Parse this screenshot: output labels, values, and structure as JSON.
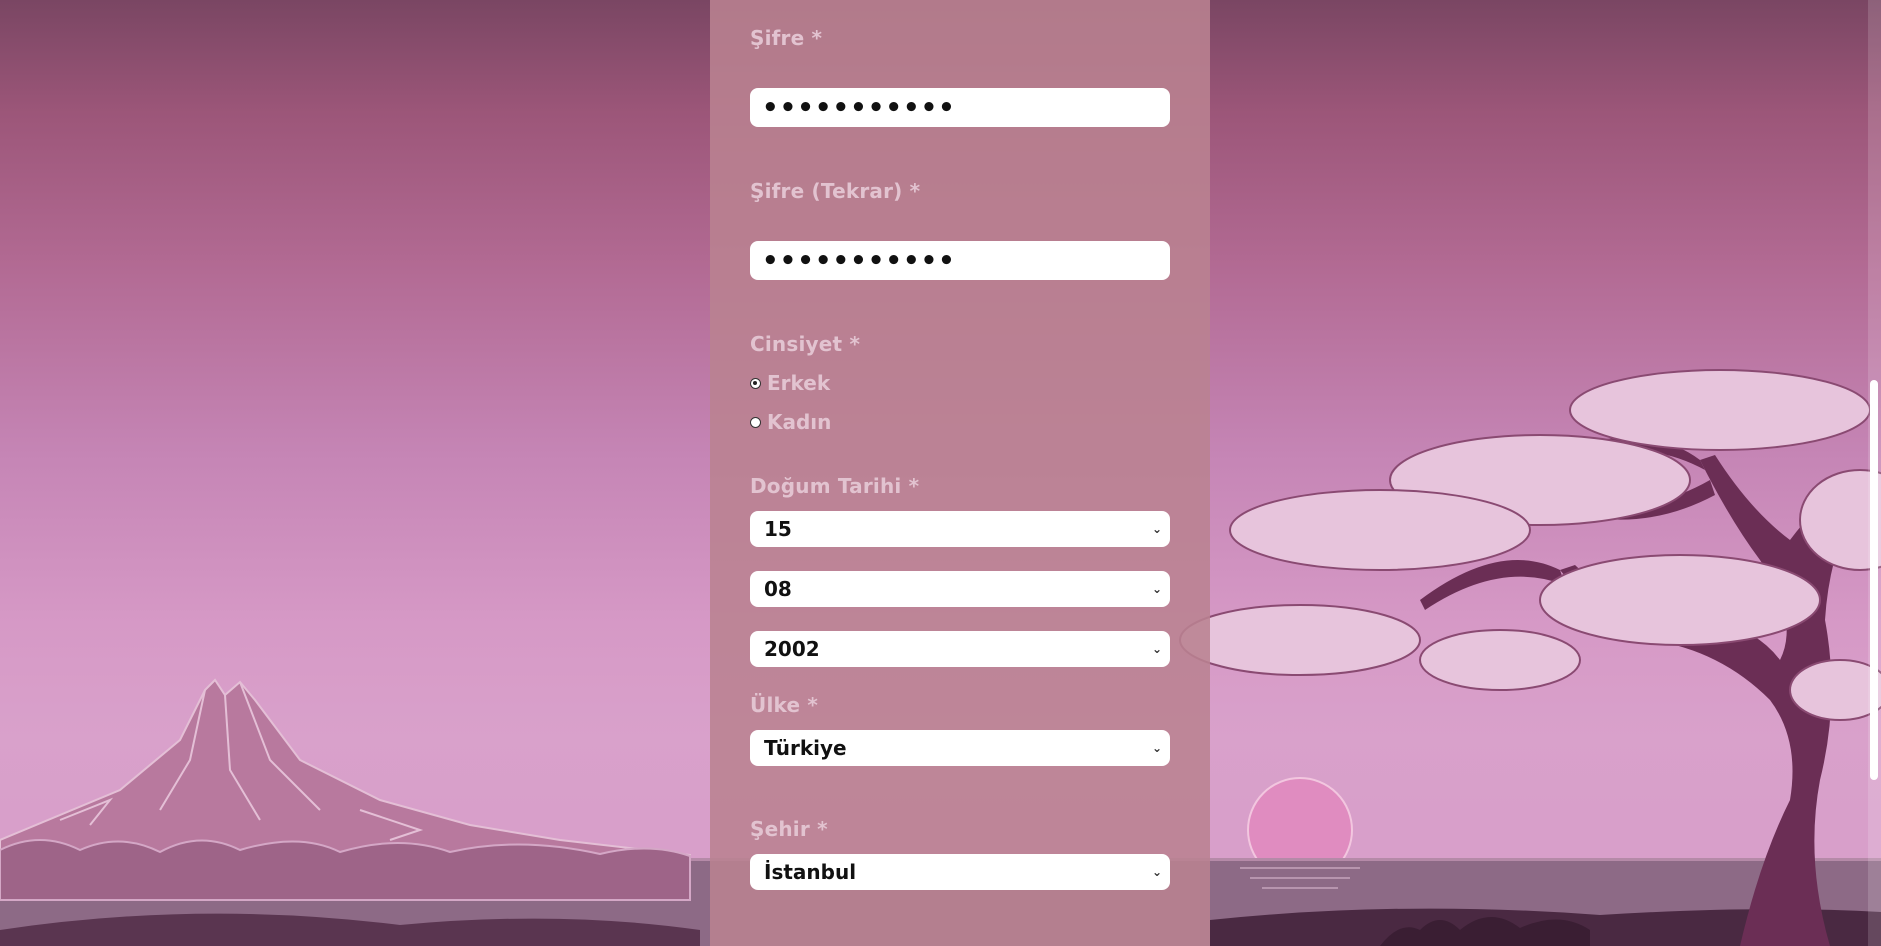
{
  "form": {
    "password": {
      "label": "Şifre *",
      "value": "•••••••••••"
    },
    "password_repeat": {
      "label": "Şifre (Tekrar) *",
      "value": "•••••••••••"
    },
    "gender": {
      "label": "Cinsiyet *",
      "options": [
        {
          "label": "Erkek",
          "selected": true
        },
        {
          "label": "Kadın",
          "selected": false
        }
      ]
    },
    "birth_date": {
      "label": "Doğum Tarihi *",
      "day": "15",
      "month": "08",
      "year": "2002"
    },
    "country": {
      "label": "Ülke *",
      "value": "Türkiye"
    },
    "city": {
      "label": "Şehir *",
      "value": "İstanbul"
    }
  },
  "icons": {
    "dropdown": "chevron-down-icon",
    "radio": "radio-button-icon"
  },
  "colors": {
    "panel": "#ba8291",
    "label": "#e2c3d0",
    "background_top": "#7a4663",
    "background_bottom": "#d89fca"
  }
}
